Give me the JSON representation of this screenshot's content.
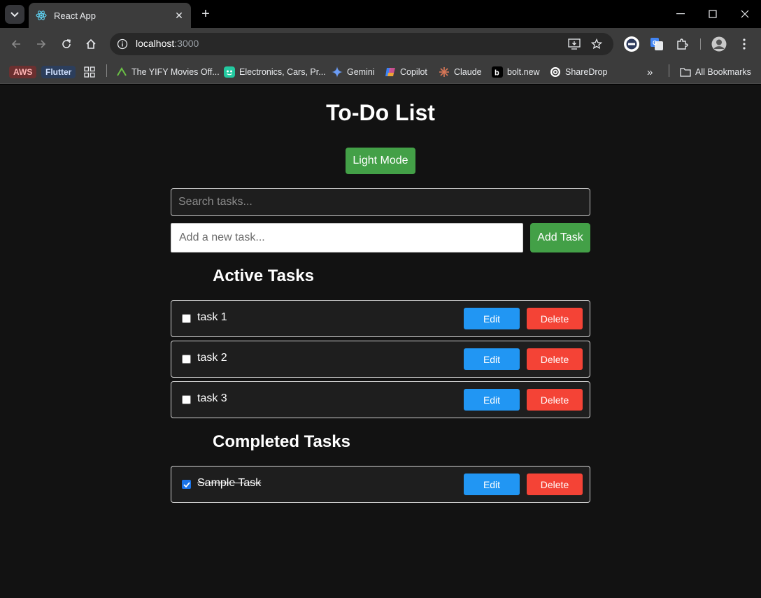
{
  "browser": {
    "tab_title": "React App",
    "url_host": "localhost",
    "url_port": ":3000",
    "bookmarks": [
      {
        "label": "AWS",
        "icon": "aws-chip"
      },
      {
        "label": "Flutter",
        "icon": "flutter-chip"
      },
      {
        "label": "",
        "icon": "apps-grid-icon"
      },
      {
        "label": "The YIFY Movies Off...",
        "icon": "yify-icon"
      },
      {
        "label": "Electronics, Cars, Pr...",
        "icon": "olx-icon"
      },
      {
        "label": "Gemini",
        "icon": "gemini-icon"
      },
      {
        "label": "Copilot",
        "icon": "copilot-icon"
      },
      {
        "label": "Claude",
        "icon": "claude-icon"
      },
      {
        "label": "bolt.new",
        "icon": "bolt-icon"
      },
      {
        "label": "ShareDrop",
        "icon": "sharedrop-icon"
      }
    ],
    "all_bookmarks_label": "All Bookmarks"
  },
  "app": {
    "title": "To-Do List",
    "theme_toggle_label": "Light Mode",
    "search_placeholder": "Search tasks...",
    "new_task_placeholder": "Add a new task...",
    "add_button_label": "Add Task",
    "active_heading": "Active Tasks",
    "completed_heading": "Completed Tasks",
    "edit_label": "Edit",
    "delete_label": "Delete",
    "active_tasks": [
      {
        "text": "task 1",
        "completed": false
      },
      {
        "text": "task 2",
        "completed": false
      },
      {
        "text": "task 3",
        "completed": false
      }
    ],
    "completed_tasks": [
      {
        "text": "Sample Task",
        "completed": true
      }
    ]
  },
  "colors": {
    "background": "#121212",
    "surface": "#1e1e1e",
    "green": "#43a047",
    "blue": "#2196f3",
    "red": "#f44336"
  }
}
